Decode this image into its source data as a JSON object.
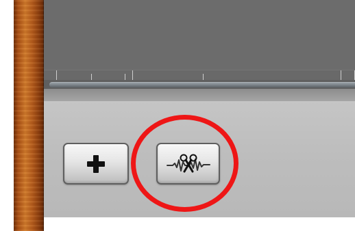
{
  "app": {
    "title": ""
  },
  "ruler": {
    "ticks": [
      {
        "type": "long"
      },
      {
        "type": "short"
      },
      {
        "type": "short"
      },
      {
        "type": "long"
      },
      {
        "type": "short"
      },
      {
        "type": "long"
      },
      {
        "type": "long"
      }
    ]
  },
  "controls": {
    "add_button": {
      "icon": "plus-icon"
    },
    "split_button": {
      "icon": "scissors-waveform-icon"
    }
  },
  "annotation": {
    "highlight_color": "#ee1616"
  },
  "colors": {
    "wood": "#b45b1c",
    "track_background": "#6c6c6c",
    "panel_background": "#c1c1c1"
  }
}
